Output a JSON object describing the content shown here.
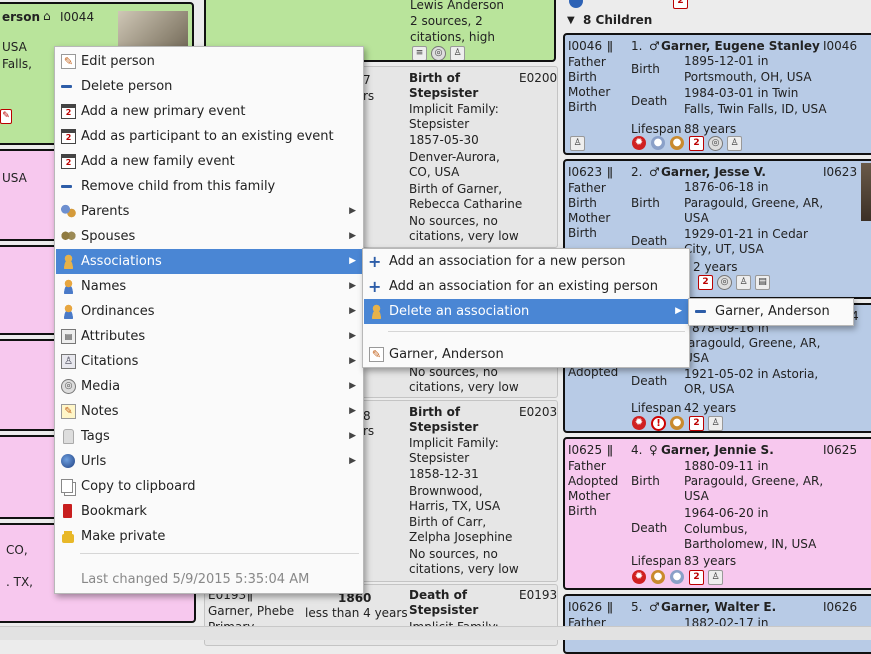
{
  "left_person": {
    "name_fragment": "erson",
    "id": "I0044",
    "lines": [
      "USA",
      "Falls,"
    ]
  },
  "top_event": {
    "lines": [
      "Lewis Anderson",
      "2 sources, 2",
      "citations, high"
    ]
  },
  "event1": {
    "title": "Birth of",
    "title2": "Stepsister",
    "id": "E0200",
    "lines": [
      "Implicit Family:",
      "Stepsister",
      "1857-05-30",
      "Denver-Aurora,",
      "CO, USA",
      "Birth of Garner,",
      "Rebecca Catharine",
      "No sources, no",
      "citations, very low"
    ],
    "side1": "7",
    "side2": "rs"
  },
  "event2_tail": [
    "No sources, no",
    "citations, very low"
  ],
  "event3": {
    "title": "Birth of",
    "title2": "Stepsister",
    "id": "E0203",
    "lines": [
      "Implicit Family:",
      "Stepsister",
      "1858-12-31",
      "Brownwood,",
      "Harris, TX, USA",
      "Birth of Carr,",
      "Zelpha Josephine",
      "No sources, no",
      "citations, very low"
    ],
    "side1": "8",
    "side2": "rs"
  },
  "event4": {
    "left_id": "E0193",
    "left_name": "Garner, Phebe",
    "left_role": "Primary",
    "year": "1860",
    "age": "less than 4 years",
    "title": "Death of",
    "title2": "Stepsister",
    "id": "E0193",
    "line": "Implicit Family:"
  },
  "left_fragments": {
    "pink1": "USA",
    "pink5a": "CO,",
    "pink5b": ". TX,"
  },
  "children_header": "8 Children",
  "children": [
    {
      "id": "I0046",
      "num": "1.",
      "sex": "♂",
      "name": "Garner, Eugene Stanley",
      "id_right": "I0046",
      "rel": [
        "Father",
        "Birth",
        "Mother",
        "Birth"
      ],
      "birth_label": "Birth",
      "birth": [
        "1895-12-01 in",
        "Portsmouth, OH, USA"
      ],
      "death_label": "Death",
      "death": [
        "1984-03-01 in Twin",
        "Falls, Twin Falls, ID, USA"
      ],
      "lifespan_label": "Lifespan",
      "lifespan": "88 years"
    },
    {
      "id": "I0623",
      "num": "2.",
      "sex": "♂",
      "name": "Garner, Jesse V.",
      "id_right": "I0623",
      "rel": [
        "Father",
        "Birth",
        "Mother",
        "Birth"
      ],
      "birth_label": "Birth",
      "birth": [
        "1876-06-18 in",
        "Paragould, Greene, AR,",
        "USA"
      ],
      "death_label": "Death",
      "death": [
        "1929-01-21 in Cedar",
        "City, UT, USA"
      ],
      "lifespan_tail": "2 years"
    },
    {
      "id": "I0624",
      "rel": [
        "Adopted"
      ],
      "birth": [
        "878-09-16 in",
        "aragould, Greene, AR,",
        "USA"
      ],
      "death_label": "Death",
      "death": [
        "1921-05-02 in Astoria,",
        "OR, USA"
      ],
      "lifespan_label": "Lifespan",
      "lifespan": "42 years",
      "id_tail": "4"
    },
    {
      "id": "I0625",
      "num": "4.",
      "sex": "♀",
      "name": "Garner, Jennie S.",
      "id_right": "I0625",
      "rel": [
        "Father",
        "Adopted",
        "Mother",
        "Birth"
      ],
      "birth_label": "Birth",
      "birth": [
        "1880-09-11 in",
        "Paragould, Greene, AR,",
        "USA"
      ],
      "death_label": "Death",
      "death": [
        "1964-06-20 in",
        "Columbus,",
        "Bartholomew, IN, USA"
      ],
      "lifespan_label": "Lifespan",
      "lifespan": "83 years"
    },
    {
      "id": "I0626",
      "num": "5.",
      "sex": "♂",
      "name": "Garner, Walter E.",
      "id_right": "I0626",
      "rel": [
        "Father"
      ],
      "birth": [
        "1882-02-17 in"
      ]
    }
  ],
  "context_menu": {
    "items": [
      {
        "label": "Edit person",
        "icon": "edit-icon"
      },
      {
        "label": "Delete person",
        "icon": "minus-icon"
      },
      {
        "label": "Add a new primary event",
        "icon": "calendar-icon"
      },
      {
        "label": "Add as participant to an existing event",
        "icon": "calendar-icon"
      },
      {
        "label": "Add a new family event",
        "icon": "calendar-icon"
      },
      {
        "label": "Remove child from this family",
        "icon": "minus-icon"
      },
      {
        "label": "Parents",
        "icon": "parents-icon"
      },
      {
        "label": "Spouses",
        "icon": "spouses-icon"
      },
      {
        "label": "Associations",
        "icon": "person-icon"
      },
      {
        "label": "Names",
        "icon": "person-icon"
      },
      {
        "label": "Ordinances",
        "icon": "person-icon"
      },
      {
        "label": "Attributes",
        "icon": "attributes-icon"
      },
      {
        "label": "Citations",
        "icon": "citation-icon"
      },
      {
        "label": "Media",
        "icon": "media-icon"
      },
      {
        "label": "Notes",
        "icon": "notes-icon"
      },
      {
        "label": "Tags",
        "icon": "tag-icon"
      },
      {
        "label": "Urls",
        "icon": "globe-icon"
      },
      {
        "label": "Copy to clipboard",
        "icon": "copy-icon"
      },
      {
        "label": "Bookmark",
        "icon": "bookmark-icon"
      },
      {
        "label": "Make private",
        "icon": "lock-icon"
      }
    ],
    "last_changed": "Last changed 5/9/2015 5:35:04 AM"
  },
  "assoc_menu": {
    "items": [
      {
        "label": "Add an association for a new person"
      },
      {
        "label": "Add an association for an existing person"
      },
      {
        "label": "Delete an association"
      }
    ],
    "existing": "Garner, Anderson"
  },
  "delete_menu": {
    "item": "Garner, Anderson"
  }
}
